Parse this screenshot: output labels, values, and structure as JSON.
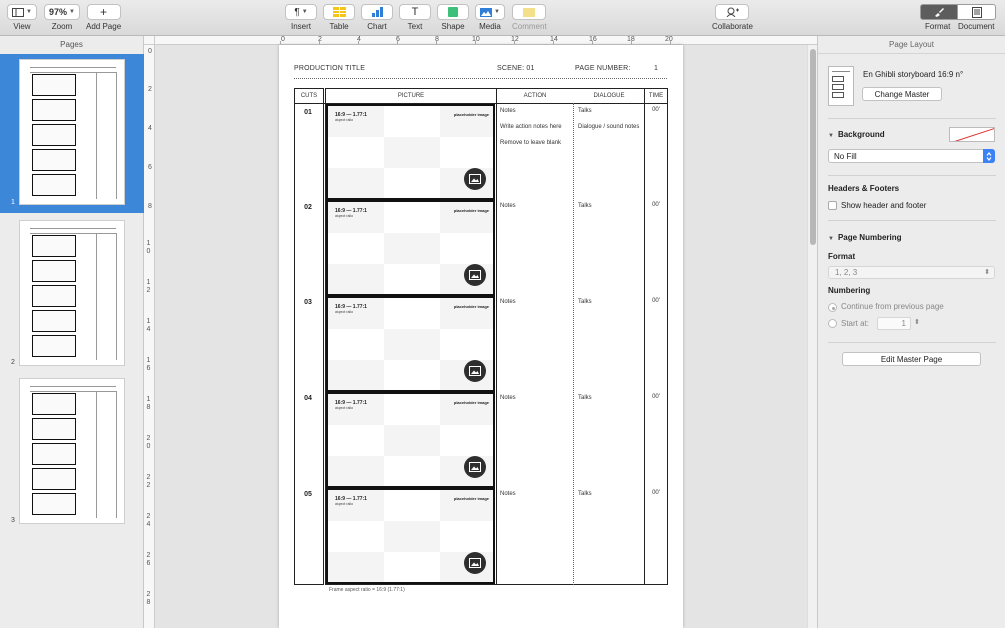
{
  "toolbar": {
    "view_label": "View",
    "zoom_value": "97%",
    "zoom_label": "Zoom",
    "add_page_label": "Add Page",
    "insert_label": "Insert",
    "table_label": "Table",
    "chart_label": "Chart",
    "text_label": "Text",
    "shape_label": "Shape",
    "media_label": "Media",
    "comment_label": "Comment",
    "collaborate_label": "Collaborate",
    "format_label": "Format",
    "document_label": "Document"
  },
  "pages_panel": {
    "title": "Pages",
    "pages": [
      {
        "number": "1",
        "selected": true
      },
      {
        "number": "2",
        "selected": false
      },
      {
        "number": "3",
        "selected": false
      }
    ]
  },
  "ruler": {
    "top": [
      "0",
      "2",
      "4",
      "6",
      "8",
      "10",
      "12",
      "14",
      "16",
      "18",
      "20"
    ],
    "left": [
      "0",
      "2",
      "4",
      "6",
      "8",
      "10",
      "12",
      "14",
      "16",
      "18",
      "20",
      "22",
      "24",
      "26",
      "28"
    ]
  },
  "document": {
    "production_title": "PRODUCTION TITLE",
    "scene_label": "SCENE: 01",
    "page_number_label": "PAGE NUMBER:",
    "page_number_value": "1",
    "columns": {
      "cuts": "CUTS",
      "picture": "PICTURE",
      "action": "ACTION",
      "dialogue": "DIALOGUE",
      "time": "TIME"
    },
    "frame_title": "16:9 — 1.77:1",
    "frame_subtitle": "aspect ratio",
    "frame_placeholder": "placeholder image",
    "rows": [
      {
        "cut": "01",
        "action": [
          "Notes",
          "Write action notes here",
          "Remove to leave blank"
        ],
        "dialogue": [
          "Talks",
          "Dialogue / sound notes"
        ],
        "time": "00'"
      },
      {
        "cut": "02",
        "action": [
          "Notes"
        ],
        "dialogue": [
          "Talks"
        ],
        "time": "00'"
      },
      {
        "cut": "03",
        "action": [
          "Notes"
        ],
        "dialogue": [
          "Talks"
        ],
        "time": "00'"
      },
      {
        "cut": "04",
        "action": [
          "Notes"
        ],
        "dialogue": [
          "Talks"
        ],
        "time": "00'"
      },
      {
        "cut": "05",
        "action": [
          "Notes"
        ],
        "dialogue": [
          "Talks"
        ],
        "time": "00'"
      }
    ],
    "footnote": "Frame aspect ratio = 16:9 (1.77:1)"
  },
  "inspector": {
    "title": "Page Layout",
    "master_name": "En Ghibli storyboard 16:9 n°",
    "change_master_label": "Change Master",
    "background_label": "Background",
    "fill_value": "No Fill",
    "headers_footers_label": "Headers & Footers",
    "show_header_footer_label": "Show header and footer",
    "page_numbering_label": "Page Numbering",
    "format_label": "Format",
    "format_value": "1, 2, 3",
    "numbering_label": "Numbering",
    "continue_label": "Continue from previous page",
    "start_at_label": "Start at:",
    "start_at_value": "1",
    "edit_master_label": "Edit Master Page"
  },
  "colors": {
    "selection_blue": "#3d87d9",
    "fill_popup_blue": "#3b82f6",
    "table_yellow": "#f5c518",
    "chart_blue": "#2f7fd8",
    "shape_green": "#3ec07a",
    "comment_yellow": "#f4e08a"
  }
}
